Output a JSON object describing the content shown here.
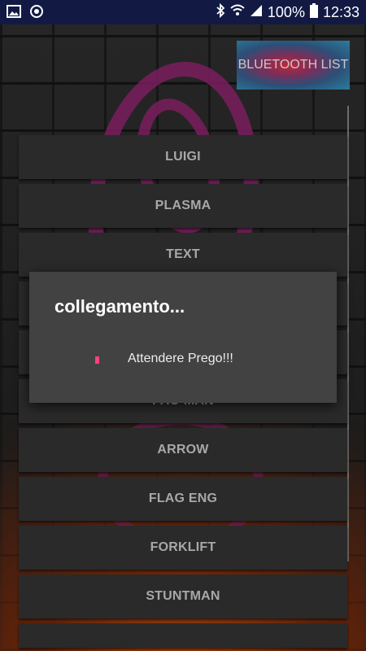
{
  "status_bar": {
    "icons_left": [
      "image-icon",
      "sync-icon"
    ],
    "icons_right": [
      "bluetooth-icon",
      "wifi-icon",
      "signal-icon",
      "battery-icon"
    ],
    "battery": "100%",
    "time": "12:33"
  },
  "bluetooth_button": {
    "label": "BLUETOOTH LIST"
  },
  "list": {
    "items": [
      {
        "label": "LUIGI"
      },
      {
        "label": "PLASMA"
      },
      {
        "label": "TEXT"
      },
      {
        "label": ""
      },
      {
        "label": ""
      },
      {
        "label": "PAC-MAN"
      },
      {
        "label": "ARROW"
      },
      {
        "label": "FLAG ENG"
      },
      {
        "label": "FORKLIFT"
      },
      {
        "label": "STUNTMAN"
      }
    ]
  },
  "dialog": {
    "title": "collegamento...",
    "message": "Attendere Prego!!!",
    "spinner_color": "#ff4081"
  },
  "colors": {
    "status_bar": "#121a44",
    "list_item_bg": "#2a2a2a",
    "list_item_text": "#a8a8a8",
    "dialog_bg": "#424242",
    "logo_magenta": "#7a1e5e"
  }
}
